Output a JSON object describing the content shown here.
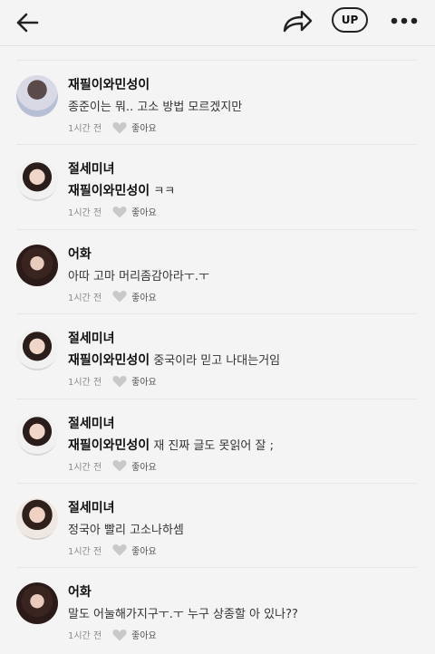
{
  "header": {
    "back_icon": "back-arrow-icon",
    "share_icon": "share-icon",
    "up_label": "UP",
    "more_icon": "more-icon"
  },
  "comments": [
    {
      "author": "재필이와민성이",
      "mention": "",
      "text": "종준이는 뭐.. 고소 방법 모르겠지만",
      "time": "1시간 전",
      "like_label": "좋아요",
      "avatar": "a1"
    },
    {
      "author": "절세미녀",
      "mention": "재필이와민성이",
      "text": "ㅋㅋ",
      "time": "1시간 전",
      "like_label": "좋아요",
      "avatar": "a2"
    },
    {
      "author": "어화",
      "mention": "",
      "text": "아따 고마 머리좀감아라ㅜ.ㅜ",
      "time": "1시간 전",
      "like_label": "좋아요",
      "avatar": "a3"
    },
    {
      "author": "절세미녀",
      "mention": "재필이와민성이",
      "text": "중국이라 믿고 나대는거임",
      "time": "1시간 전",
      "like_label": "좋아요",
      "avatar": "a2"
    },
    {
      "author": "절세미녀",
      "mention": "재필이와민성이",
      "text": "재 진짜 글도 못읽어 잘 ;",
      "time": "1시간 전",
      "like_label": "좋아요",
      "avatar": "a2"
    },
    {
      "author": "절세미녀",
      "mention": "",
      "text": "정국아 빨리 고소나하셈",
      "time": "1시간 전",
      "like_label": "좋아요",
      "avatar": "a4"
    },
    {
      "author": "어화",
      "mention": "",
      "text": "말도 어눌해가지구ㅜ.ㅜ 누구 상종할 아 있나??",
      "time": "1시간 전",
      "like_label": "좋아요",
      "avatar": "a3"
    }
  ]
}
